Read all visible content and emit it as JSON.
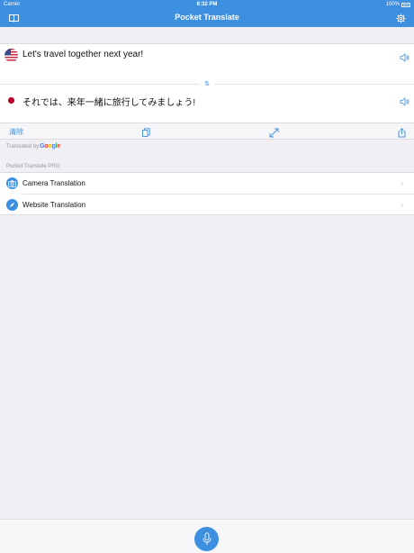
{
  "status_bar": {
    "carrier": "Carrier",
    "time": "6:32 PM",
    "battery": "100%"
  },
  "nav": {
    "title": "Pocket Translate",
    "left_icon": "book-icon",
    "right_icon": "gear-icon"
  },
  "translation": {
    "source_text": "Let's travel together next year!",
    "source_flag": "us-flag-icon",
    "target_text": "それでは、来年一緒に旅行してみましょう!",
    "target_flag": "japan-flag-icon",
    "swap_icon": "swap-icon"
  },
  "toolbar": {
    "clear_label": "清除",
    "icons": [
      "copy-icon",
      "expand-icon",
      "share-icon"
    ]
  },
  "attribution": {
    "prefix": "Translated by",
    "provider": "Google"
  },
  "pro_section": {
    "header": "Pocket Translate PRO",
    "items": [
      {
        "label": "Camera Translation",
        "icon": "camera-icon"
      },
      {
        "label": "Website Translation",
        "icon": "compass-icon"
      }
    ]
  },
  "bottom": {
    "mic_icon": "microphone-icon"
  },
  "colors": {
    "accent": "#3d8fe0",
    "background": "#efeff4"
  }
}
